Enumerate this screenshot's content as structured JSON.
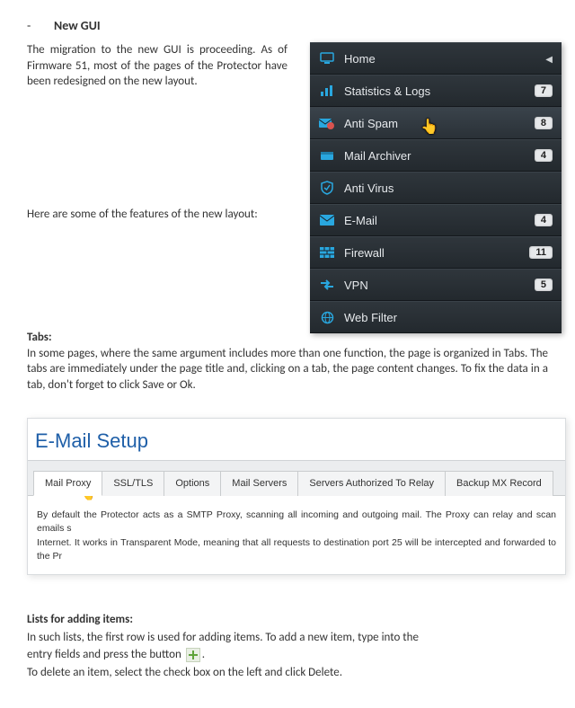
{
  "heading": "New GUI",
  "intro": "The migration to the new GUI is proceeding. As of Firmware 51, most of the pages of the Protector have been redesigned on the new layout.",
  "features_line": "Here are some of the features of the new layout:",
  "sidemenu": {
    "items": [
      {
        "label": "Home",
        "icon": "monitor-icon",
        "badge": "",
        "caret": true,
        "hover": false
      },
      {
        "label": "Statistics & Logs",
        "icon": "bars-icon",
        "badge": "7",
        "caret": false,
        "hover": false
      },
      {
        "label": "Anti Spam",
        "icon": "envelope-x-icon",
        "badge": "8",
        "caret": false,
        "hover": true
      },
      {
        "label": "Mail Archiver",
        "icon": "inbox-icon",
        "badge": "4",
        "caret": false,
        "hover": false
      },
      {
        "label": "Anti Virus",
        "icon": "shield-icon",
        "badge": "",
        "caret": false,
        "hover": false
      },
      {
        "label": "E-Mail",
        "icon": "envelope-icon",
        "badge": "4",
        "caret": false,
        "hover": false
      },
      {
        "label": "Firewall",
        "icon": "brick-icon",
        "badge": "11",
        "caret": false,
        "hover": false
      },
      {
        "label": "VPN",
        "icon": "lock-swap-icon",
        "badge": "5",
        "caret": false,
        "hover": false
      },
      {
        "label": "Web Filter",
        "icon": "globe-icon",
        "badge": "",
        "caret": false,
        "hover": false
      }
    ]
  },
  "tabs_section": {
    "title": "Tabs:",
    "body": "In some pages, where the same argument includes more than one function, the page is organized in Tabs. The tabs are immediately under the page title and, clicking on a tab, the page content changes. To fix the data in a tab, don't forget to click Save or Ok."
  },
  "email_setup": {
    "title": "E-Mail Setup",
    "tabs": [
      {
        "label": "Mail Proxy",
        "active": true
      },
      {
        "label": "SSL/TLS",
        "active": false
      },
      {
        "label": "Options",
        "active": false
      },
      {
        "label": "Mail Servers",
        "active": false
      },
      {
        "label": "Servers Authorized To Relay",
        "active": false
      },
      {
        "label": "Backup MX Record",
        "active": false
      }
    ],
    "body1": "By default the Protector acts as a SMTP Proxy, scanning all incoming and outgoing mail. The Proxy can relay and scan emails s",
    "body2": "Internet. It works in Transparent Mode, meaning that all requests to destination port 25 will be intercepted and forwarded to the Pr"
  },
  "lists_section": {
    "title": "Lists for adding items:",
    "line1": "In such lists, the first row is used for adding items. To add a new item, type into the",
    "line2a": "entry fields and press the button ",
    "line2b": ".",
    "line3": "To delete an item, select the check box on the left and click Delete."
  }
}
